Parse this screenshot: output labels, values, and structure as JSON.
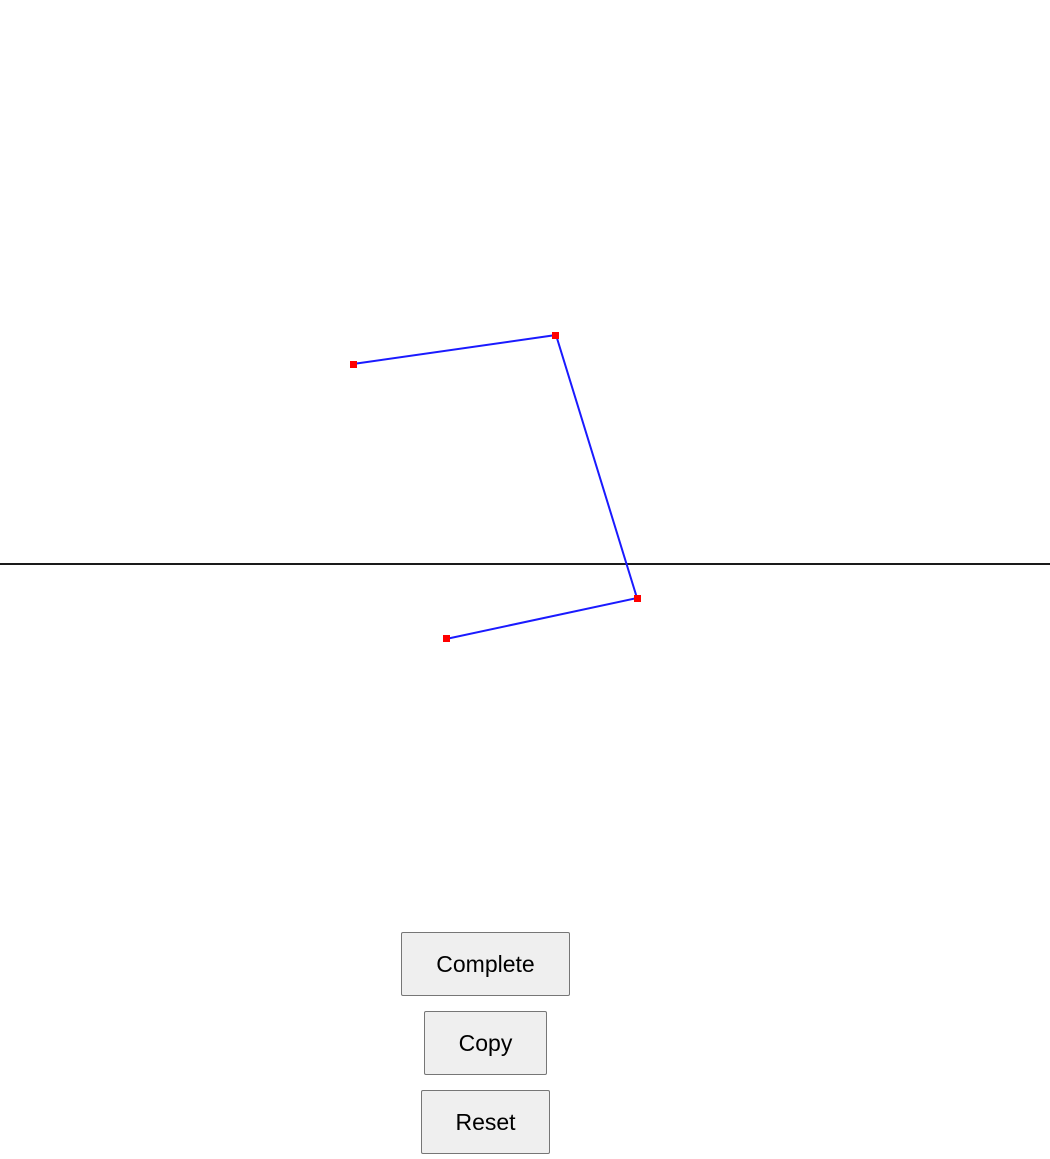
{
  "colors": {
    "background": "#ffffff",
    "horizon_line": "#1a1a1a",
    "segment": "#1a1aff",
    "point": "#ff0000",
    "button_bg": "#efefef",
    "button_border": "#767676"
  },
  "buttons": {
    "complete_label": "Complete",
    "copy_label": "Copy",
    "reset_label": "Reset"
  }
}
